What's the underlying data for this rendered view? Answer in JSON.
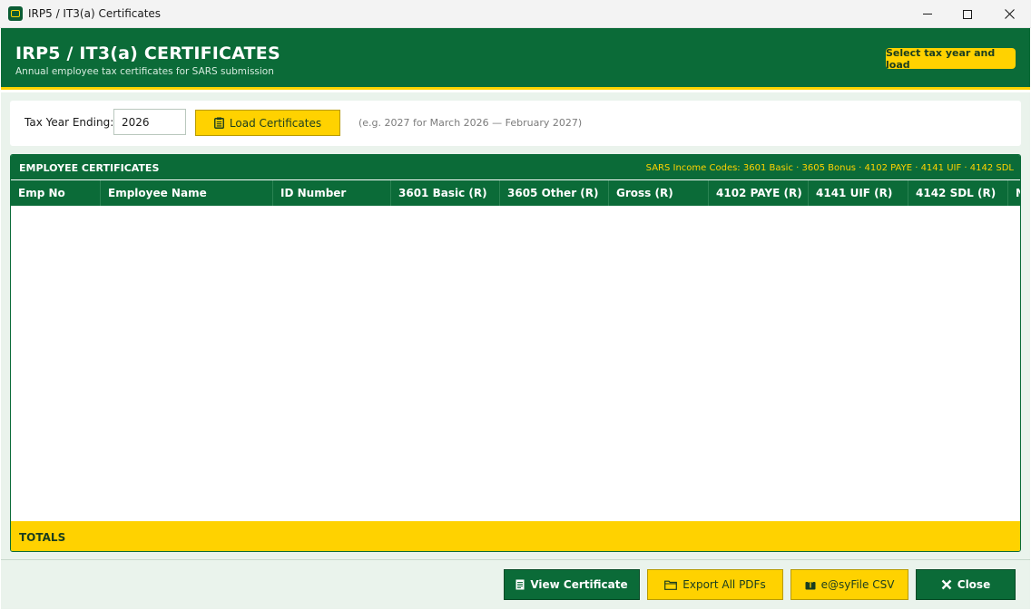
{
  "window": {
    "title": "IRP5 / IT3(a) Certificates",
    "icon": "app-icon"
  },
  "header": {
    "title": "IRP5 / IT3(a) CERTIFICATES",
    "subtitle": "Annual employee tax certificates for SARS submission",
    "badge": "Select tax year and load"
  },
  "load_bar": {
    "tax_year_label": "Tax Year Ending:",
    "tax_year_value": "2026",
    "load_button": "Load Certificates",
    "hint": "(e.g. 2027 for March 2026 — February 2027)"
  },
  "panel": {
    "title": "EMPLOYEE CERTIFICATES",
    "codes": "SARS Income Codes: 3601 Basic · 3605 Bonus · 4102 PAYE · 4141 UIF · 4142 SDL",
    "columns": [
      "Emp No",
      "Employee Name",
      "ID Number",
      "3601 Basic (R)",
      "3605 Other (R)",
      "Gross (R)",
      "4102 PAYE (R)",
      "4141 UIF (R)",
      "4142 SDL (R)",
      "N"
    ],
    "rows": [],
    "totals_label": "TOTALS"
  },
  "footer": {
    "view_certificate": "View Certificate",
    "export_pdfs": "Export All PDFs",
    "efile_csv": "e@syFile CSV",
    "close": "Close"
  },
  "colors": {
    "primary_green": "#0b6b38",
    "accent_yellow": "#ffd200",
    "background_mint": "#eaf3ec"
  }
}
